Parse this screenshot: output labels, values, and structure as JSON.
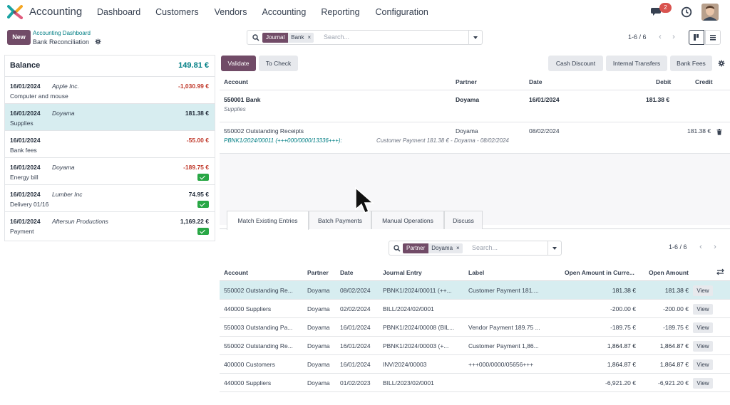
{
  "app": {
    "name": "Accounting",
    "menu": [
      "Dashboard",
      "Customers",
      "Vendors",
      "Accounting",
      "Reporting",
      "Configuration"
    ],
    "chat_badge": "2"
  },
  "control": {
    "new_label": "New",
    "breadcrumb_parent": "Accounting Dashboard",
    "breadcrumb_current": "Bank Reconciliation",
    "search": {
      "facet_key": "Journal",
      "facet_value": "Bank",
      "placeholder": "Search..."
    },
    "pager": "1-6 / 6"
  },
  "left": {
    "balance_label": "Balance",
    "balance_value": "149.81 €",
    "lines": [
      {
        "date": "16/01/2024",
        "partner": "Apple Inc.",
        "amount": "-1,030.99 €",
        "label": "Computer and mouse",
        "negative": true,
        "checked": false,
        "selected": false
      },
      {
        "date": "16/01/2024",
        "partner": "Doyama",
        "amount": "181.38 €",
        "label": "Supplies",
        "negative": false,
        "checked": false,
        "selected": true
      },
      {
        "date": "16/01/2024",
        "partner": "",
        "amount": "-55.00 €",
        "label": "Bank fees",
        "negative": true,
        "checked": false,
        "selected": false
      },
      {
        "date": "16/01/2024",
        "partner": "Doyama",
        "amount": "-189.75 €",
        "label": "Energy bill",
        "negative": true,
        "checked": true,
        "selected": false
      },
      {
        "date": "16/01/2024",
        "partner": "Lumber Inc",
        "amount": "74.95 €",
        "label": "Delivery 01/16",
        "negative": false,
        "checked": true,
        "selected": false
      },
      {
        "date": "16/01/2024",
        "partner": "Aftersun Productions",
        "amount": "1,169.22 €",
        "label": "Payment",
        "negative": false,
        "checked": true,
        "selected": false
      }
    ]
  },
  "toolbar": {
    "validate": "Validate",
    "to_check": "To Check",
    "cash_discount": "Cash Discount",
    "internal_transfers": "Internal Transfers",
    "bank_fees": "Bank Fees"
  },
  "top_table": {
    "headers": {
      "account": "Account",
      "partner": "Partner",
      "date": "Date",
      "debit": "Debit",
      "credit": "Credit"
    },
    "row1": {
      "account": "550001 Bank",
      "sub": "Supplies",
      "partner": "Doyama",
      "date": "16/01/2024",
      "debit": "181.38 €"
    },
    "row2": {
      "account": "550002 Outstanding Receipts",
      "partner": "Doyama",
      "date": "08/02/2024",
      "credit": "181.38 €",
      "link": "PBNK1/2024/00011 (+++000/0000/13336+++):",
      "desc": "Customer Payment 181.38 € - Doyama - 08/02/2024"
    }
  },
  "tabs": [
    "Match Existing Entries",
    "Batch Payments",
    "Manual Operations",
    "Discuss"
  ],
  "match_search": {
    "facet_key": "Partner",
    "facet_value": "Doyama",
    "placeholder": "Search...",
    "pager": "1-6 / 6"
  },
  "bottom_table": {
    "headers": {
      "account": "Account",
      "partner": "Partner",
      "date": "Date",
      "journal_entry": "Journal Entry",
      "label": "Label",
      "open_currency": "Open Amount in Curre...",
      "open_amount": "Open Amount"
    },
    "view_label": "View",
    "rows": [
      {
        "account": "550002 Outstanding Re...",
        "partner": "Doyama",
        "date": "08/02/2024",
        "entry": "PBNK1/2024/00011 (++...",
        "label": "Customer Payment 181....",
        "open_cur": "181.38 €",
        "open_amt": "181.38 €",
        "negative": false,
        "highlight": true
      },
      {
        "account": "440000 Suppliers",
        "partner": "Doyama",
        "date": "02/02/2024",
        "entry": "BILL/2024/02/0001",
        "label": "",
        "open_cur": "-200.00 €",
        "open_amt": "-200.00 €",
        "negative": true,
        "highlight": false
      },
      {
        "account": "550003 Outstanding Pa...",
        "partner": "Doyama",
        "date": "16/01/2024",
        "entry": "PBNK1/2024/00008 (BIL...",
        "label": "Vendor Payment 189.75 ...",
        "open_cur": "-189.75 €",
        "open_amt": "-189.75 €",
        "negative": true,
        "highlight": false
      },
      {
        "account": "550002 Outstanding Re...",
        "partner": "Doyama",
        "date": "16/01/2024",
        "entry": "PBNK1/2024/00003 (+...",
        "label": "Customer Payment 1,86...",
        "open_cur": "1,864.87 €",
        "open_amt": "1,864.87 €",
        "negative": false,
        "highlight": false
      },
      {
        "account": "400000 Customers",
        "partner": "Doyama",
        "date": "16/01/2024",
        "entry": "INV/2024/00003",
        "label": "+++000/0000/05656+++",
        "open_cur": "1,864.87 €",
        "open_amt": "1,864.87 €",
        "negative": false,
        "highlight": false
      },
      {
        "account": "440000 Suppliers",
        "partner": "Doyama",
        "date": "01/02/2023",
        "entry": "BILL/2023/02/0001",
        "label": "",
        "open_cur": "-6,921.20 €",
        "open_amt": "-6,921.20 €",
        "negative": true,
        "highlight": false
      }
    ]
  },
  "colors": {
    "brand": "#714B67",
    "teal": "#017e84",
    "negative": "#c0392b",
    "selected_row": "#d7edf0",
    "check_green": "#28a745"
  }
}
